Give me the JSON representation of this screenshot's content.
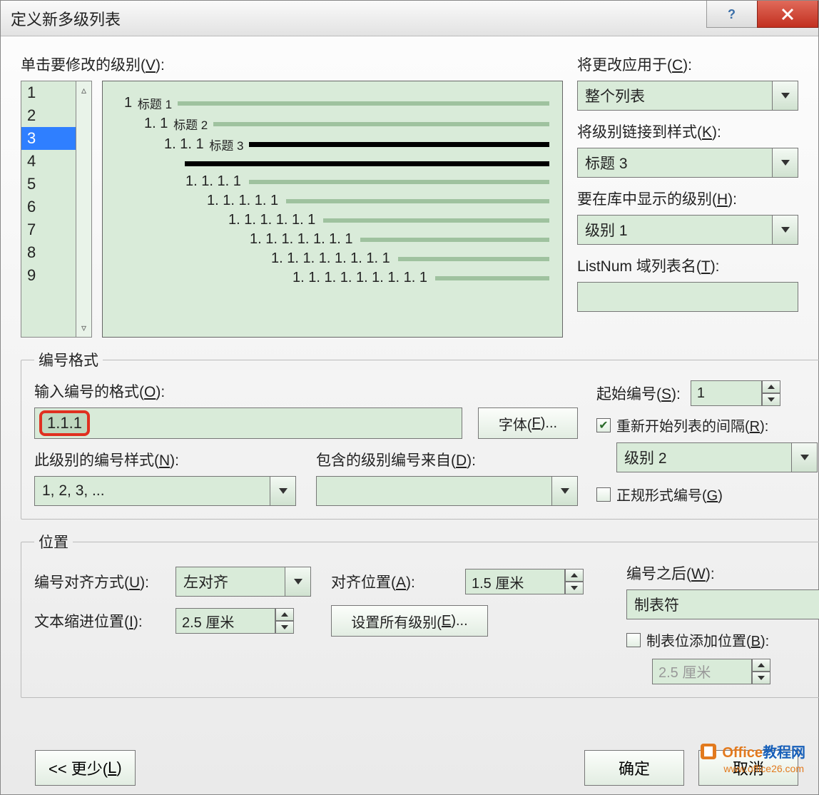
{
  "title": "定义新多级列表",
  "labels": {
    "click_level": "单击要修改的级别(",
    "click_level_u": "V",
    "apply_to": "将更改应用于(",
    "apply_to_u": "C",
    "link_style": "将级别链接到样式(",
    "link_style_u": "K",
    "show_in_gallery": "要在库中显示的级别(",
    "show_in_gallery_u": "H",
    "listnum": "ListNum 域列表名(",
    "listnum_u": "T",
    "num_format": "编号格式",
    "enter_format": "输入编号的格式(",
    "enter_format_u": "O",
    "font_btn": "字体(",
    "font_btn_u": "F",
    "font_btn_suffix": ")...",
    "num_style": "此级别的编号样式(",
    "num_style_u": "N",
    "include_from": "包含的级别编号来自(",
    "include_from_u": "D",
    "start_at": "起始编号(",
    "start_at_u": "S",
    "restart": "重新开始列表的间隔(",
    "restart_u": "R",
    "legal": "正规形式编号(",
    "legal_u": "G",
    "position": "位置",
    "align": "编号对齐方式(",
    "align_u": "U",
    "align_at": "对齐位置(",
    "align_at_u": "A",
    "text_indent": "文本缩进位置(",
    "text_indent_u": "I",
    "set_all": "设置所有级别(",
    "set_all_u": "E",
    "set_all_suffix": ")...",
    "follow": "编号之后(",
    "follow_u": "W",
    "tab_add": "制表位添加位置(",
    "tab_add_u": "B",
    "less": "<< 更少(",
    "less_u": "L",
    "ok": "确定",
    "cancel": "取消"
  },
  "levels": [
    "1",
    "2",
    "3",
    "4",
    "5",
    "6",
    "7",
    "8",
    "9"
  ],
  "selected_level_index": 2,
  "preview": [
    {
      "cls": "l1",
      "num": "1",
      "txt": "标题 1",
      "bold": false
    },
    {
      "cls": "l2",
      "num": "1. 1",
      "txt": "标题 2",
      "bold": false
    },
    {
      "cls": "l3",
      "num": "1. 1. 1",
      "txt": "标题 3",
      "bold": true
    },
    {
      "cls": "lsolo",
      "num": "",
      "txt": "",
      "bold": true
    },
    {
      "cls": "l4",
      "num": "1. 1. 1. 1",
      "txt": "",
      "bold": false
    },
    {
      "cls": "l5",
      "num": "1. 1. 1. 1. 1",
      "txt": "",
      "bold": false
    },
    {
      "cls": "l6",
      "num": "1. 1. 1. 1. 1. 1",
      "txt": "",
      "bold": false
    },
    {
      "cls": "l7",
      "num": "1. 1. 1. 1. 1. 1. 1",
      "txt": "",
      "bold": false
    },
    {
      "cls": "l8",
      "num": "1. 1. 1. 1. 1. 1. 1. 1",
      "txt": "",
      "bold": false
    },
    {
      "cls": "l9",
      "num": "1. 1. 1. 1. 1. 1. 1. 1. 1",
      "txt": "",
      "bold": false
    }
  ],
  "apply_to_val": "整个列表",
  "link_style_val": "标题 3",
  "show_gallery_val": "级别 1",
  "listnum_val": "",
  "num_format_val": "1.1.1",
  "num_style_val": "1, 2, 3, ...",
  "include_from_val": "",
  "start_at_val": "1",
  "restart_checked": true,
  "restart_val": "级别 2",
  "legal_checked": false,
  "align_val": "左对齐",
  "align_at_val": "1.5 厘米",
  "text_indent_val": "2.5 厘米",
  "follow_val": "制表符",
  "tab_add_checked": false,
  "tab_add_val": "2.5 厘米",
  "watermark_top": "Office教程网",
  "watermark_sub": "www.office26.com"
}
